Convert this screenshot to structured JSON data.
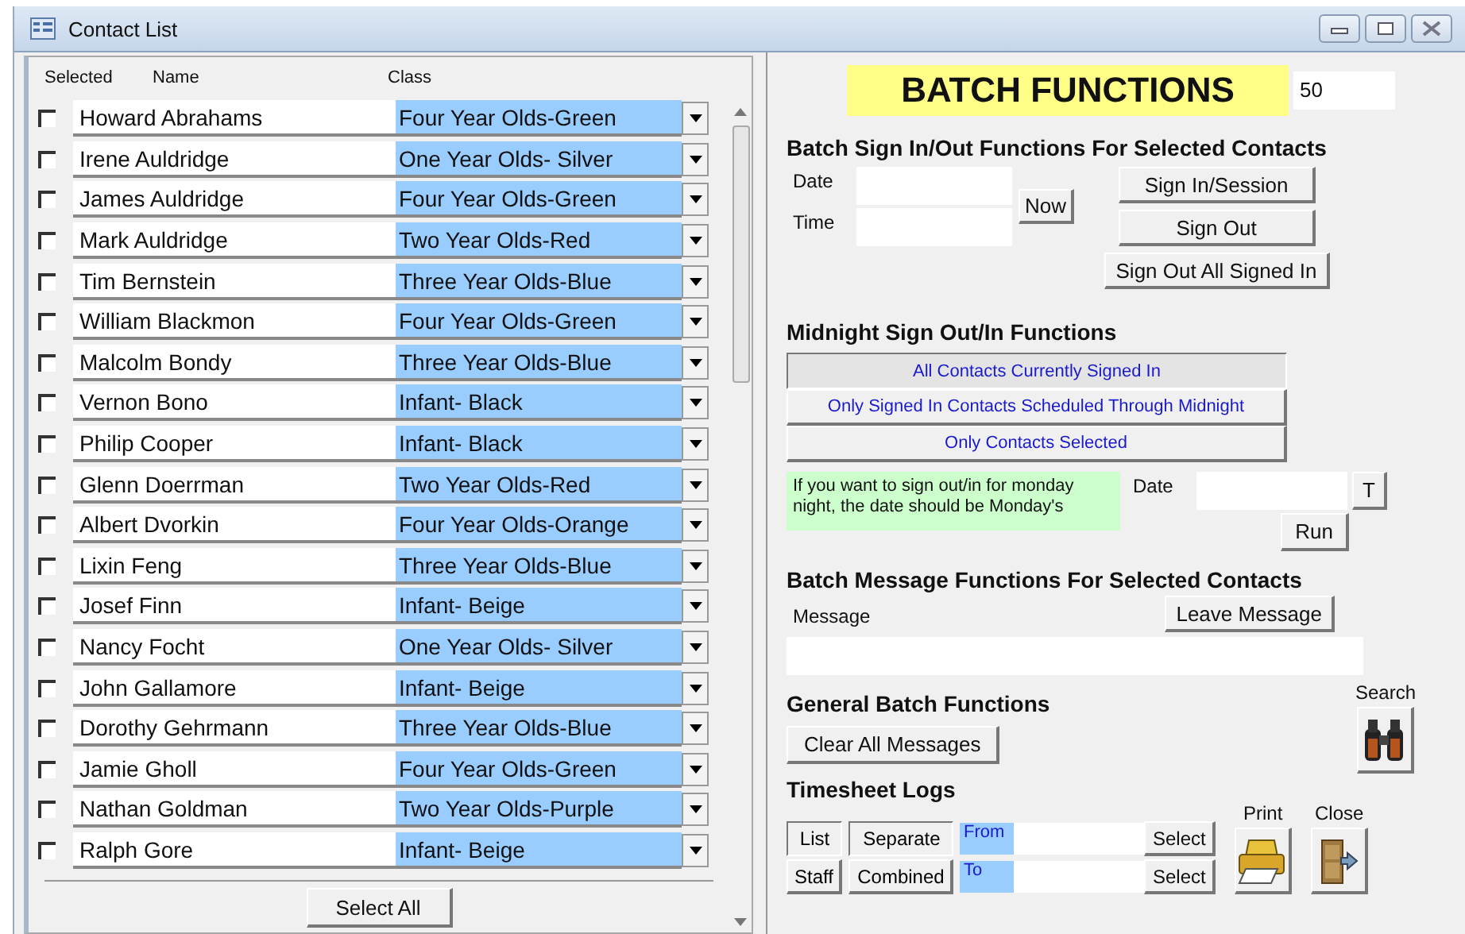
{
  "window": {
    "title": "Contact List"
  },
  "list": {
    "columns": [
      "Selected",
      "Name",
      "Class"
    ],
    "rows": [
      {
        "checked": false,
        "name": "Howard Abrahams",
        "class": "Four Year Olds-Green"
      },
      {
        "checked": false,
        "name": "Irene Auldridge",
        "class": "One Year Olds- Silver"
      },
      {
        "checked": false,
        "name": "James Auldridge",
        "class": "Four Year Olds-Green"
      },
      {
        "checked": false,
        "name": "Mark Auldridge",
        "class": "Two Year Olds-Red"
      },
      {
        "checked": false,
        "name": "Tim Bernstein",
        "class": "Three Year Olds-Blue"
      },
      {
        "checked": false,
        "name": "William Blackmon",
        "class": "Four Year Olds-Green"
      },
      {
        "checked": false,
        "name": "Malcolm Bondy",
        "class": "Three Year Olds-Blue"
      },
      {
        "checked": false,
        "name": "Vernon Bono",
        "class": "Infant- Black"
      },
      {
        "checked": false,
        "name": "Philip Cooper",
        "class": "Infant- Black"
      },
      {
        "checked": false,
        "name": "Glenn Doerrman",
        "class": "Two Year Olds-Red"
      },
      {
        "checked": false,
        "name": "Albert Dvorkin",
        "class": "Four Year Olds-Orange"
      },
      {
        "checked": false,
        "name": "Lixin Feng",
        "class": "Three Year Olds-Blue"
      },
      {
        "checked": false,
        "name": "Josef Finn",
        "class": "Infant- Beige"
      },
      {
        "checked": false,
        "name": "Nancy Focht",
        "class": "One Year Olds- Silver"
      },
      {
        "checked": false,
        "name": "John Gallamore",
        "class": "Infant- Beige"
      },
      {
        "checked": false,
        "name": "Dorothy Gehrmann",
        "class": "Three Year Olds-Blue"
      },
      {
        "checked": false,
        "name": "Jamie Gholl",
        "class": "Four Year Olds-Green"
      },
      {
        "checked": false,
        "name": "Nathan Goldman",
        "class": "Two Year Olds-Purple"
      },
      {
        "checked": false,
        "name": "Ralph Gore",
        "class": "Infant- Beige"
      }
    ],
    "select_all": "Select All"
  },
  "batch": {
    "title": "BATCH FUNCTIONS",
    "count": "50"
  },
  "sign_in_out": {
    "heading": "Batch Sign In/Out Functions For Selected Contacts",
    "date_label": "Date",
    "time_label": "Time",
    "now": "Now",
    "buttons": [
      "Sign In/Session",
      "Sign Out",
      "Sign Out All Signed In"
    ]
  },
  "midnight": {
    "heading": "Midnight Sign Out/In Functions",
    "options": [
      {
        "label": "All Contacts Currently Signed In",
        "selected": true
      },
      {
        "label": "Only Signed In Contacts Scheduled Through Midnight",
        "selected": false
      },
      {
        "label": "Only Contacts Selected",
        "selected": false
      }
    ],
    "note": "If you want to sign out/in for monday night, the date should be Monday's",
    "date_label": "Date",
    "today": "T",
    "run": "Run"
  },
  "message": {
    "heading": "Batch Message Functions For Selected Contacts",
    "label": "Message",
    "leave": "Leave Message"
  },
  "general": {
    "heading": "General Batch Functions",
    "clear": "Clear All Messages",
    "search": "Search"
  },
  "timesheet": {
    "heading": "Timesheet Logs",
    "mode": [
      {
        "label": "List",
        "selected": true
      },
      {
        "label": "Staff",
        "selected": false
      }
    ],
    "grouping": [
      {
        "label": "Separate",
        "selected": true
      },
      {
        "label": "Combined",
        "selected": false
      }
    ],
    "from": "From",
    "to": "To",
    "select": [
      "Select",
      "Select"
    ],
    "print": "Print",
    "close": "Close"
  }
}
